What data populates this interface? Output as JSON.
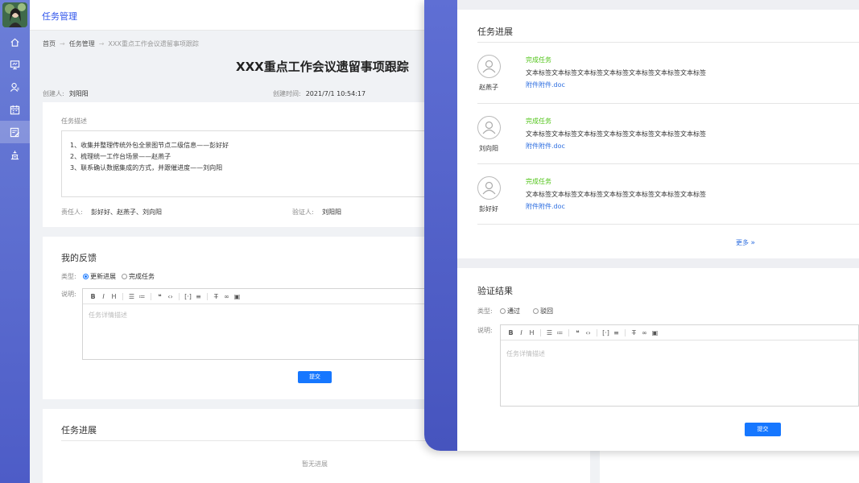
{
  "app": {
    "section_title": "任务管理"
  },
  "sidebar": {
    "items": [
      {
        "name": "home-icon"
      },
      {
        "name": "monitor-icon"
      },
      {
        "name": "user-icon"
      },
      {
        "name": "calendar-icon"
      },
      {
        "name": "task-edit-icon",
        "active": true
      },
      {
        "name": "podium-icon"
      }
    ]
  },
  "breadcrumb": {
    "home": "首页",
    "section": "任务管理",
    "current": "XXX重点工作会议遗留事项跟踪"
  },
  "task": {
    "title": "XXX重点工作会议遗留事项跟踪",
    "creator_label": "创建人:",
    "creator": "刘阳阳",
    "created_label": "创建时间:",
    "created_at": "2021/7/1 10:54:17",
    "desc_label": "任务描述",
    "desc_lines": [
      "1、收集并整理传统外包全景图节点二级信息——彭好好",
      "2、梳理统一工作台场景——赵燕子",
      "3、联系确认数据集成的方式，并跟催进度——刘向阳"
    ],
    "owner_label": "责任人:",
    "owners": "彭好好、赵燕子、刘向阳",
    "verifier_label": "验证人:",
    "verifier": "刘阳阳"
  },
  "feedback": {
    "title": "我的反馈",
    "type_label": "类型:",
    "options": [
      "更新进展",
      "完成任务"
    ],
    "selected": "更新进展",
    "note_label": "说明:",
    "placeholder": "任务详情描述",
    "submit": "提交"
  },
  "progress_left": {
    "title": "任务进展",
    "empty": "暂无进展"
  },
  "progress": {
    "title": "任务进展",
    "entries": [
      {
        "name": "赵燕子",
        "status": "完成任务",
        "text": "文本标签文本标签文本标签文本标签文本标签文本标签文本标签",
        "attachment": "附件附件.doc"
      },
      {
        "name": "刘向阳",
        "status": "完成任务",
        "text": "文本标签文本标签文本标签文本标签文本标签文本标签文本标签",
        "attachment": "附件附件.doc"
      },
      {
        "name": "彭好好",
        "status": "完成任务",
        "text": "文本标签文本标签文本标签文本标签文本标签文本标签文本标签",
        "attachment": "附件附件.doc"
      }
    ],
    "more": "更多"
  },
  "verify": {
    "title": "验证结果",
    "type_label": "类型:",
    "options": [
      "通过",
      "驳回"
    ],
    "note_label": "说明:",
    "placeholder": "任务详情描述",
    "submit": "提交"
  },
  "toolbar_icons": [
    "bold-icon",
    "italic-icon",
    "heading-icon",
    "ordered-list-icon",
    "bullet-list-icon",
    "quote-icon",
    "code-icon",
    "bracket-icon",
    "align-icon",
    "clear-format-icon",
    "link-icon",
    "image-icon"
  ],
  "colors": {
    "accent": "#2f54eb",
    "primary_button": "#1677ff",
    "success": "#52c41a",
    "sidebar": "#5a6bd0"
  }
}
